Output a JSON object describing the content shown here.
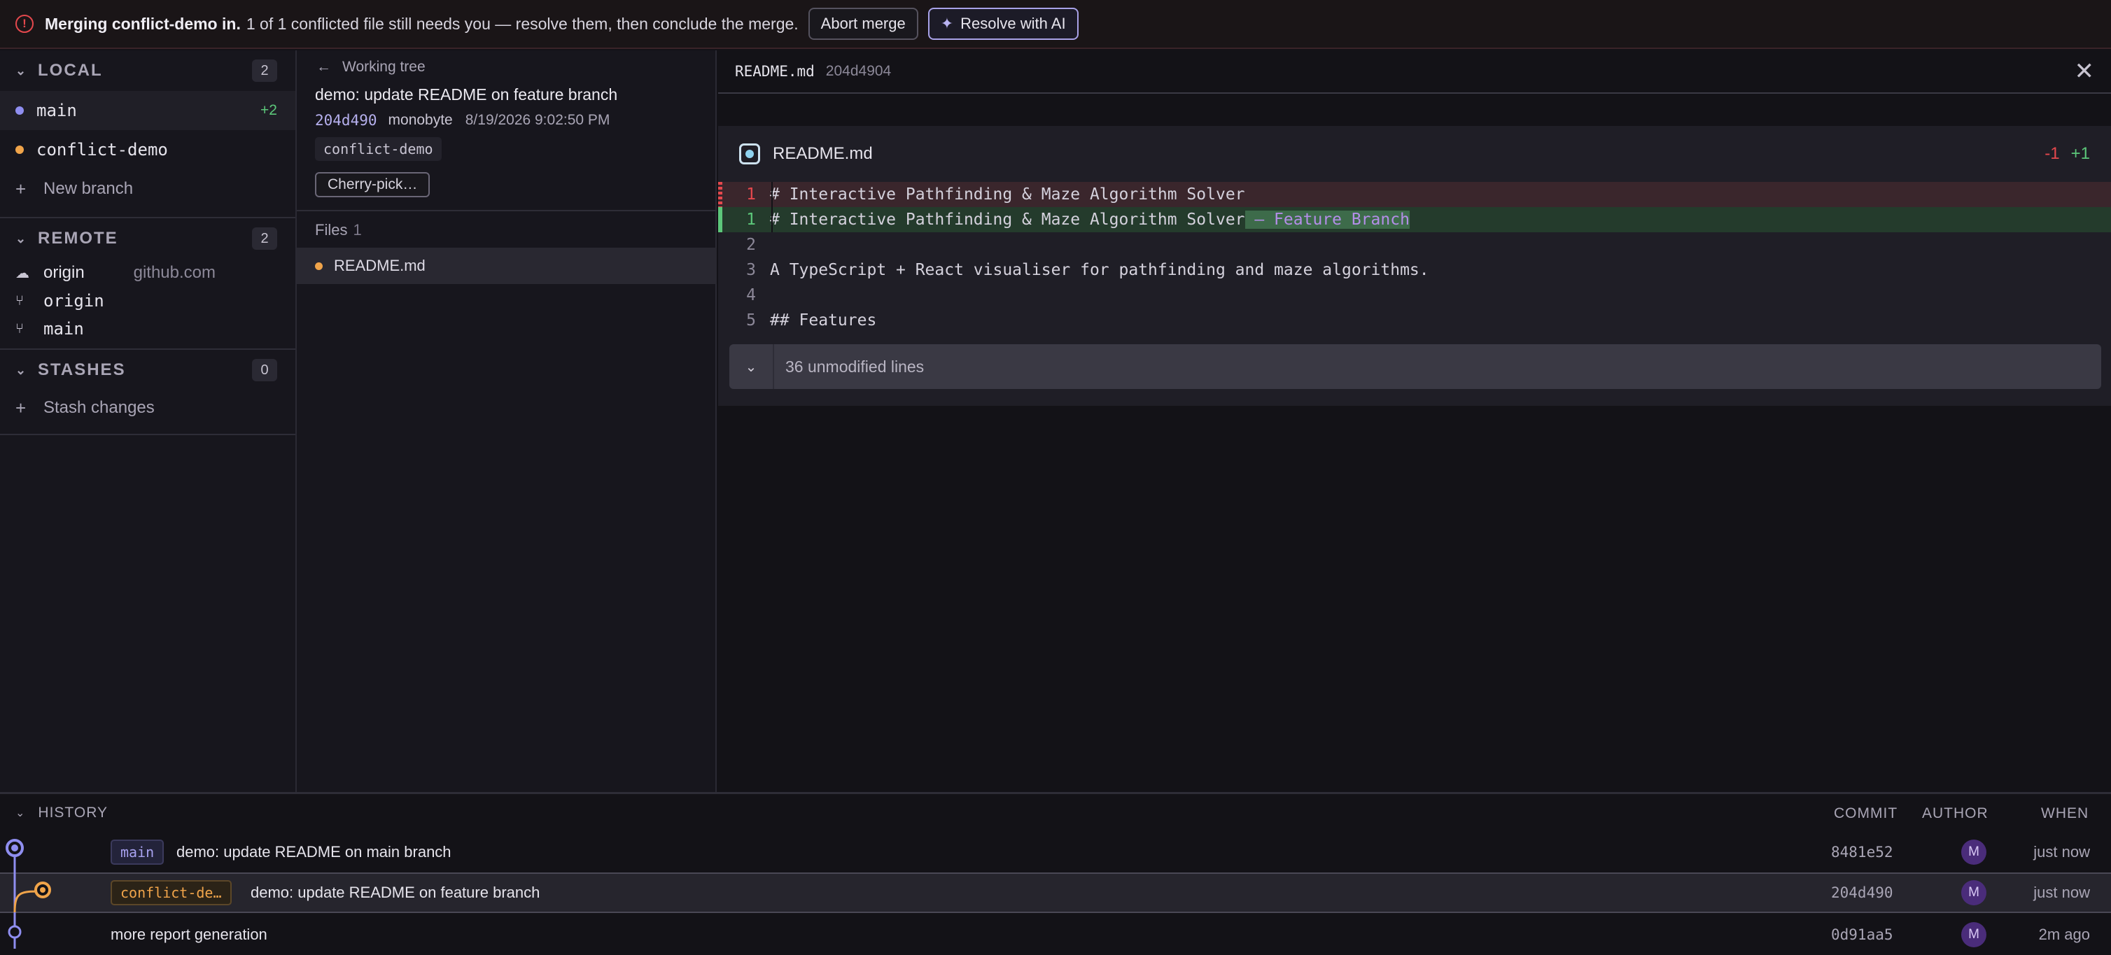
{
  "banner": {
    "title": "Merging conflict-demo in.",
    "message": "1 of 1 conflicted file still needs you — resolve them, then conclude the merge.",
    "abort_label": "Abort merge",
    "ai_label": "Resolve with AI",
    "icon": "alert-circle-icon"
  },
  "sidebar": {
    "local": {
      "title": "LOCAL",
      "count": "2",
      "branches": [
        {
          "name": "main",
          "ahead": "+2",
          "color": "#8f8ef0"
        },
        {
          "name": "conflict-demo",
          "ahead": "",
          "color": "#f0a44a"
        }
      ],
      "new_branch": "New branch"
    },
    "remote": {
      "title": "REMOTE",
      "count": "2",
      "origin": {
        "name": "origin",
        "host": "github.com"
      },
      "branches": [
        "origin",
        "main"
      ]
    },
    "stashes": {
      "title": "STASHES",
      "count": "0",
      "action": "Stash changes"
    }
  },
  "commit": {
    "back_label": "Working tree",
    "message": "demo: update README on feature branch",
    "hash": "204d490",
    "author": "monobyte",
    "date": "8/19/2026 9:02:50 PM",
    "branch": "conflict-demo",
    "cherry_pick": "Cherry-pick…",
    "files_label": "Files",
    "files_count": "1",
    "files": [
      {
        "name": "README.md",
        "status_color": "#f0a44a"
      }
    ]
  },
  "diff": {
    "header_file": "README.md",
    "header_hash": "204d4904",
    "card_file": "README.md",
    "deletions": "-1",
    "additions": "+1",
    "lines": [
      {
        "num": "1",
        "type": "del",
        "text": "# Interactive Pathfinding & Maze Algorithm Solver"
      },
      {
        "num": "1",
        "type": "add",
        "text": "# Interactive Pathfinding & Maze Algorithm Solver",
        "added": " — Feature Branch"
      },
      {
        "num": "2",
        "type": "ctx",
        "text": ""
      },
      {
        "num": "3",
        "type": "ctx",
        "text": "A TypeScript + React visualiser for pathfinding and maze algorithms."
      },
      {
        "num": "4",
        "type": "ctx",
        "text": ""
      },
      {
        "num": "5",
        "type": "ctx",
        "text": "## Features"
      }
    ],
    "unmodified": "36 unmodified lines"
  },
  "history": {
    "title": "HISTORY",
    "columns": {
      "commit": "COMMIT",
      "author": "AUTHOR",
      "when": "WHEN"
    },
    "rows": [
      {
        "tag": "main",
        "message": "demo: update README on main branch",
        "hash": "8481e52",
        "avatar": "M",
        "when": "just now"
      },
      {
        "tag": "conflict-de…",
        "message": "demo: update README on feature branch",
        "hash": "204d490",
        "avatar": "M",
        "when": "just now"
      },
      {
        "tag": "",
        "message": "more report generation",
        "hash": "0d91aa5",
        "avatar": "M",
        "when": "2m ago"
      }
    ]
  }
}
